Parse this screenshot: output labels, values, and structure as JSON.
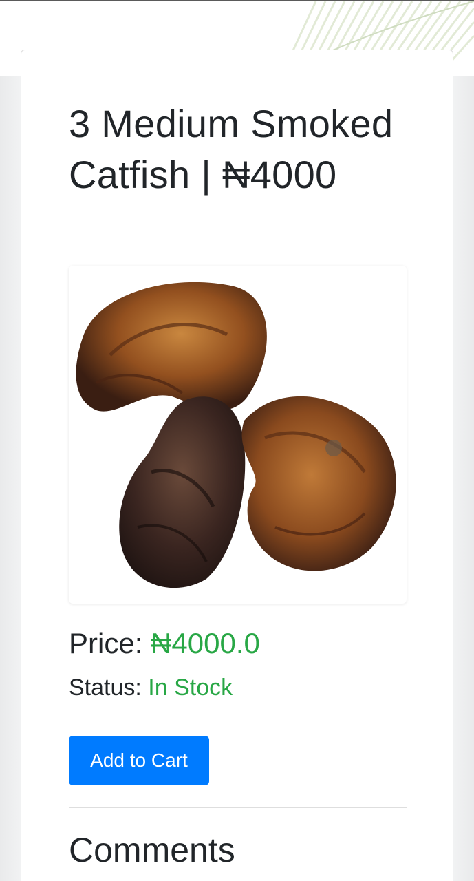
{
  "product": {
    "title": "3 Medium Smoked Catfish | ₦4000",
    "image_alt": "Three smoked catfish"
  },
  "price": {
    "label": "Price: ",
    "value": "₦4000.0"
  },
  "status": {
    "label": "Status: ",
    "value": "In Stock"
  },
  "actions": {
    "add_to_cart_label": "Add to Cart"
  },
  "comments": {
    "heading": "Comments"
  },
  "colors": {
    "accent": "#007bff",
    "success": "#28a745",
    "text": "#212529"
  }
}
